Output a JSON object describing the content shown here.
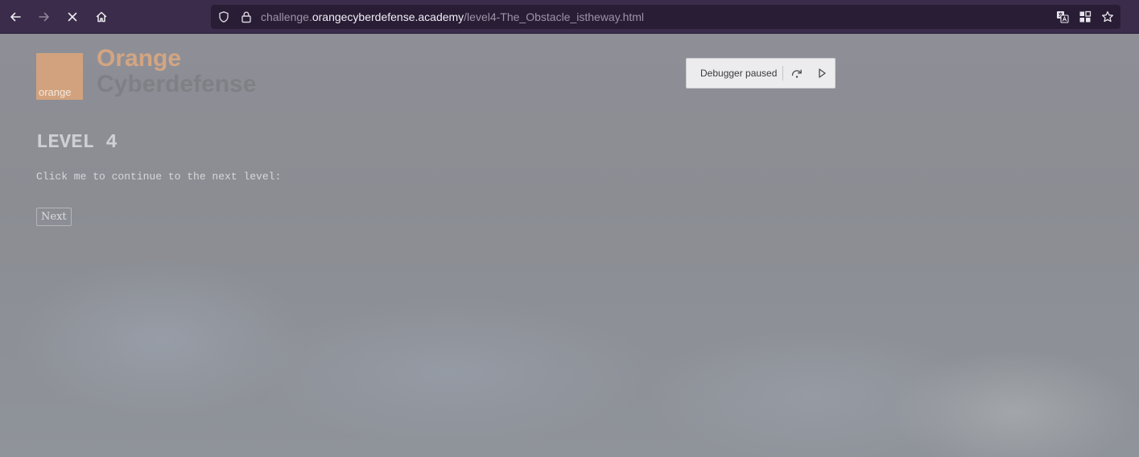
{
  "browser": {
    "url_prefix": "challenge.",
    "url_domain": "orangecyberdefense.academy",
    "url_path": "/level4-The_Obstacle_istheway.html",
    "toolbar_color": "#3a2c4a",
    "urlbar_color": "#281d35",
    "icons": [
      "back-arrow-icon",
      "forward-arrow-icon",
      "stop-loading-icon",
      "home-icon",
      "tracking-protection-shield-icon",
      "lock-icon",
      "translate-icon",
      "reader-grid-icon",
      "bookmark-star-icon"
    ]
  },
  "logo": {
    "box_text": "orange",
    "line1": "Orange",
    "line2": "Cyberdefense",
    "accent_color": "#d2a27e"
  },
  "main": {
    "title": "LEVEL 4",
    "instruction": "Click me to continue to the next level:",
    "next_label": "Next"
  },
  "debugger": {
    "label": "Debugger paused",
    "icons": [
      "step-over-icon",
      "resume-icon"
    ]
  }
}
